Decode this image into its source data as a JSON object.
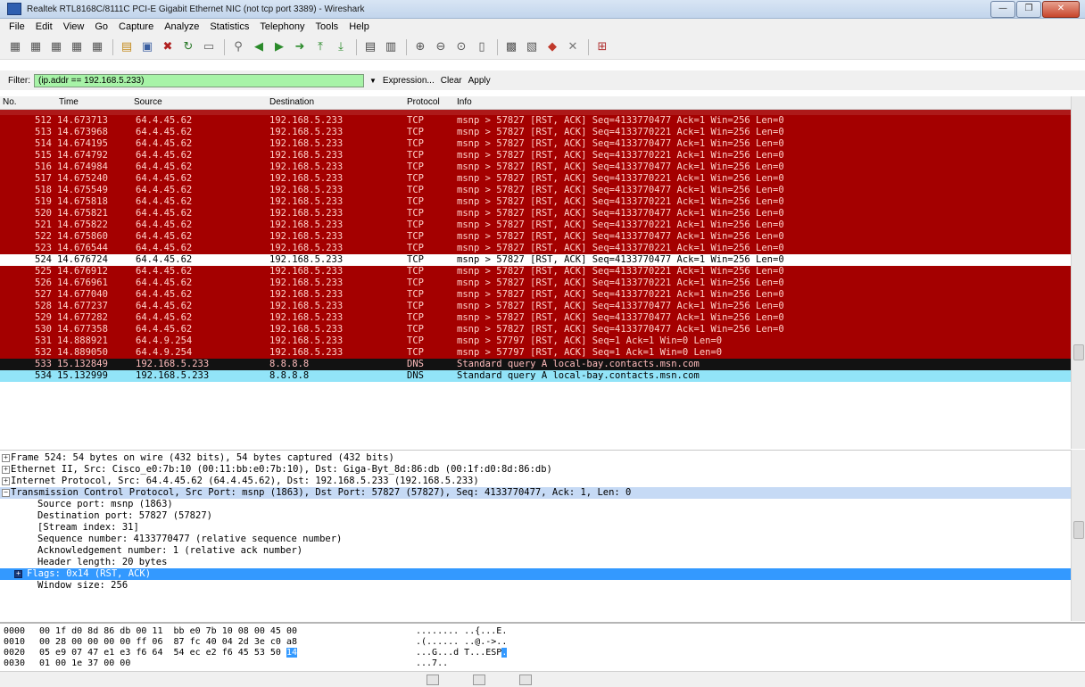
{
  "window": {
    "title": "Realtek RTL8168C/8111C PCI-E Gigabit Ethernet NIC (not tcp port 3389) - Wireshark",
    "min": "—",
    "max": "❐",
    "close": "✕"
  },
  "menu": [
    "File",
    "Edit",
    "View",
    "Go",
    "Capture",
    "Analyze",
    "Statistics",
    "Telephony",
    "Tools",
    "Help"
  ],
  "toolbar_icons": [
    "interface-list-icon",
    "capture-options-icon",
    "start-capture-icon",
    "stop-capture-icon",
    "restart-capture-icon",
    "open-file-icon",
    "save-file-icon",
    "close-file-icon",
    "reload-icon",
    "print-icon",
    "find-packet-icon",
    "go-back-icon",
    "go-forward-icon",
    "go-to-packet-icon",
    "go-first-icon",
    "go-last-icon",
    "colorize-icon",
    "autoscroll-icon",
    "zoom-in-icon",
    "zoom-out-icon",
    "normal-size-icon",
    "resize-columns-icon",
    "capture-filters-icon",
    "display-filters-icon",
    "coloring-rules-icon",
    "preferences-icon",
    "help-icon"
  ],
  "filter": {
    "label": "Filter:",
    "value": "(ip.addr == 192.168.5.233)",
    "expression": "Expression...",
    "clear": "Clear",
    "apply": "Apply"
  },
  "columns": {
    "no": "No.",
    "time": "Time",
    "source": "Source",
    "destination": "Destination",
    "protocol": "Protocol",
    "info": "Info"
  },
  "packets": [
    {
      "no": "512",
      "time": "14.673713",
      "src": "64.4.45.62",
      "dst": "192.168.5.233",
      "proto": "TCP",
      "info": "msnp > 57827 [RST, ACK] Seq=4133770477 Ack=1 Win=256 Len=0",
      "color": "red"
    },
    {
      "no": "513",
      "time": "14.673968",
      "src": "64.4.45.62",
      "dst": "192.168.5.233",
      "proto": "TCP",
      "info": "msnp > 57827 [RST, ACK] Seq=4133770221 Ack=1 Win=256 Len=0",
      "color": "red"
    },
    {
      "no": "514",
      "time": "14.674195",
      "src": "64.4.45.62",
      "dst": "192.168.5.233",
      "proto": "TCP",
      "info": "msnp > 57827 [RST, ACK] Seq=4133770477 Ack=1 Win=256 Len=0",
      "color": "red"
    },
    {
      "no": "515",
      "time": "14.674792",
      "src": "64.4.45.62",
      "dst": "192.168.5.233",
      "proto": "TCP",
      "info": "msnp > 57827 [RST, ACK] Seq=4133770221 Ack=1 Win=256 Len=0",
      "color": "red"
    },
    {
      "no": "516",
      "time": "14.674984",
      "src": "64.4.45.62",
      "dst": "192.168.5.233",
      "proto": "TCP",
      "info": "msnp > 57827 [RST, ACK] Seq=4133770477 Ack=1 Win=256 Len=0",
      "color": "red"
    },
    {
      "no": "517",
      "time": "14.675240",
      "src": "64.4.45.62",
      "dst": "192.168.5.233",
      "proto": "TCP",
      "info": "msnp > 57827 [RST, ACK] Seq=4133770221 Ack=1 Win=256 Len=0",
      "color": "red"
    },
    {
      "no": "518",
      "time": "14.675549",
      "src": "64.4.45.62",
      "dst": "192.168.5.233",
      "proto": "TCP",
      "info": "msnp > 57827 [RST, ACK] Seq=4133770477 Ack=1 Win=256 Len=0",
      "color": "red"
    },
    {
      "no": "519",
      "time": "14.675818",
      "src": "64.4.45.62",
      "dst": "192.168.5.233",
      "proto": "TCP",
      "info": "msnp > 57827 [RST, ACK] Seq=4133770221 Ack=1 Win=256 Len=0",
      "color": "red"
    },
    {
      "no": "520",
      "time": "14.675821",
      "src": "64.4.45.62",
      "dst": "192.168.5.233",
      "proto": "TCP",
      "info": "msnp > 57827 [RST, ACK] Seq=4133770477 Ack=1 Win=256 Len=0",
      "color": "red"
    },
    {
      "no": "521",
      "time": "14.675822",
      "src": "64.4.45.62",
      "dst": "192.168.5.233",
      "proto": "TCP",
      "info": "msnp > 57827 [RST, ACK] Seq=4133770221 Ack=1 Win=256 Len=0",
      "color": "red"
    },
    {
      "no": "522",
      "time": "14.675860",
      "src": "64.4.45.62",
      "dst": "192.168.5.233",
      "proto": "TCP",
      "info": "msnp > 57827 [RST, ACK] Seq=4133770477 Ack=1 Win=256 Len=0",
      "color": "red"
    },
    {
      "no": "523",
      "time": "14.676544",
      "src": "64.4.45.62",
      "dst": "192.168.5.233",
      "proto": "TCP",
      "info": "msnp > 57827 [RST, ACK] Seq=4133770221 Ack=1 Win=256 Len=0",
      "color": "red"
    },
    {
      "no": "524",
      "time": "14.676724",
      "src": "64.4.45.62",
      "dst": "192.168.5.233",
      "proto": "TCP",
      "info": "msnp > 57827 [RST, ACK] Seq=4133770477 Ack=1 Win=256 Len=0",
      "color": "white"
    },
    {
      "no": "525",
      "time": "14.676912",
      "src": "64.4.45.62",
      "dst": "192.168.5.233",
      "proto": "TCP",
      "info": "msnp > 57827 [RST, ACK] Seq=4133770221 Ack=1 Win=256 Len=0",
      "color": "red"
    },
    {
      "no": "526",
      "time": "14.676961",
      "src": "64.4.45.62",
      "dst": "192.168.5.233",
      "proto": "TCP",
      "info": "msnp > 57827 [RST, ACK] Seq=4133770221 Ack=1 Win=256 Len=0",
      "color": "red"
    },
    {
      "no": "527",
      "time": "14.677040",
      "src": "64.4.45.62",
      "dst": "192.168.5.233",
      "proto": "TCP",
      "info": "msnp > 57827 [RST, ACK] Seq=4133770221 Ack=1 Win=256 Len=0",
      "color": "red"
    },
    {
      "no": "528",
      "time": "14.677237",
      "src": "64.4.45.62",
      "dst": "192.168.5.233",
      "proto": "TCP",
      "info": "msnp > 57827 [RST, ACK] Seq=4133770477 Ack=1 Win=256 Len=0",
      "color": "red"
    },
    {
      "no": "529",
      "time": "14.677282",
      "src": "64.4.45.62",
      "dst": "192.168.5.233",
      "proto": "TCP",
      "info": "msnp > 57827 [RST, ACK] Seq=4133770477 Ack=1 Win=256 Len=0",
      "color": "red"
    },
    {
      "no": "530",
      "time": "14.677358",
      "src": "64.4.45.62",
      "dst": "192.168.5.233",
      "proto": "TCP",
      "info": "msnp > 57827 [RST, ACK] Seq=4133770477 Ack=1 Win=256 Len=0",
      "color": "red"
    },
    {
      "no": "531",
      "time": "14.888921",
      "src": "64.4.9.254",
      "dst": "192.168.5.233",
      "proto": "TCP",
      "info": "msnp > 57797 [RST, ACK] Seq=1 Ack=1 Win=0 Len=0",
      "color": "red"
    },
    {
      "no": "532",
      "time": "14.889050",
      "src": "64.4.9.254",
      "dst": "192.168.5.233",
      "proto": "TCP",
      "info": "msnp > 57797 [RST, ACK] Seq=1 Ack=1 Win=0 Len=0",
      "color": "red"
    },
    {
      "no": "533",
      "time": "15.132849",
      "src": "192.168.5.233",
      "dst": "8.8.8.8",
      "proto": "DNS",
      "info": "Standard query A local-bay.contacts.msn.com",
      "color": "black"
    },
    {
      "no": "534",
      "time": "15.132999",
      "src": "192.168.5.233",
      "dst": "8.8.8.8",
      "proto": "DNS",
      "info": "Standard query A local-bay.contacts.msn.com",
      "color": "cyan"
    }
  ],
  "details": [
    {
      "text": "Frame 524: 54 bytes on wire (432 bits), 54 bytes captured (432 bits)",
      "expander": "+",
      "style": "normal",
      "indent": 0
    },
    {
      "text": "Ethernet II, Src: Cisco_e0:7b:10 (00:11:bb:e0:7b:10), Dst: Giga-Byt_8d:86:db (00:1f:d0:8d:86:db)",
      "expander": "+",
      "style": "normal",
      "indent": 0
    },
    {
      "text": "Internet Protocol, Src: 64.4.45.62 (64.4.45.62), Dst: 192.168.5.233 (192.168.5.233)",
      "expander": "+",
      "style": "normal",
      "indent": 0
    },
    {
      "text": "Transmission Control Protocol, Src Port: msnp (1863), Dst Port: 57827 (57827), Seq: 4133770477, Ack: 1, Len: 0",
      "expander": "−",
      "style": "selected",
      "indent": 0
    },
    {
      "text": "Source port: msnp (1863)",
      "expander": "",
      "style": "normal",
      "indent": 1
    },
    {
      "text": "Destination port: 57827 (57827)",
      "expander": "",
      "style": "normal",
      "indent": 1
    },
    {
      "text": "[Stream index: 31]",
      "expander": "",
      "style": "normal",
      "indent": 1
    },
    {
      "text": "Sequence number: 4133770477    (relative sequence number)",
      "expander": "",
      "style": "normal",
      "indent": 1
    },
    {
      "text": "Acknowledgement number: 1    (relative ack number)",
      "expander": "",
      "style": "normal",
      "indent": 1
    },
    {
      "text": "Header length: 20 bytes",
      "expander": "",
      "style": "normal",
      "indent": 1
    },
    {
      "text": "Flags: 0x14 (RST, ACK)",
      "expander": "+",
      "style": "flags",
      "indent": 0
    },
    {
      "text": "Window size: 256",
      "expander": "",
      "style": "normal",
      "indent": 1
    }
  ],
  "hex": [
    {
      "offset": "0000",
      "bytes_a": "00 1f d0 8d 86 db 00 11  bb e0 7b 10 08 00 45 00",
      "bytes_hl": "",
      "ascii_a": "........ ..{...E.",
      "ascii_hl": ""
    },
    {
      "offset": "0010",
      "bytes_a": "00 28 00 00 00 00 ff 06  87 fc 40 04 2d 3e c0 a8",
      "bytes_hl": "",
      "ascii_a": ".(...... ..@.->..",
      "ascii_hl": ""
    },
    {
      "offset": "0020",
      "bytes_a": "05 e9 07 47 e1 e3 f6 64  54 ec e2 f6 45 53 50 ",
      "bytes_hl": "14",
      "ascii_a": "...G...d T...ESP",
      "ascii_hl": "."
    },
    {
      "offset": "0030",
      "bytes_a": "01 00 1e 37 00 00",
      "bytes_hl": "",
      "ascii_a": "...7..",
      "ascii_hl": ""
    }
  ],
  "colors": {
    "row_red": "#a40000",
    "row_black": "#121212",
    "row_cyan": "#92e4f8",
    "filter_ok": "#a7f3a7",
    "selection": "#3399ff"
  }
}
